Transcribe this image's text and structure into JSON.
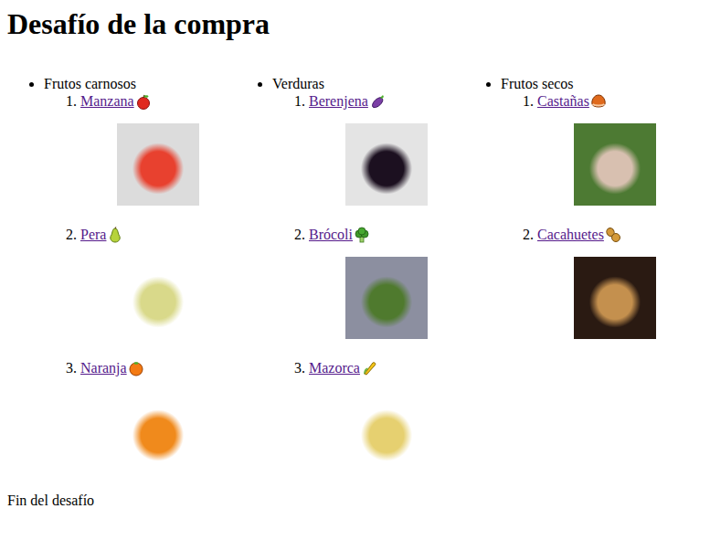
{
  "title": "Desafío de la compra",
  "categories": [
    {
      "name": "Frutos carnosos",
      "items": [
        {
          "number": "1.",
          "label": "Manzana"
        },
        {
          "number": "2.",
          "label": "Pera"
        },
        {
          "number": "3.",
          "label": "Naranja"
        }
      ]
    },
    {
      "name": "Verduras",
      "items": [
        {
          "number": "1.",
          "label": "Berenjena"
        },
        {
          "number": "2.",
          "label": "Brócoli"
        },
        {
          "number": "3.",
          "label": "Mazorca"
        }
      ]
    },
    {
      "name": "Frutos secos",
      "items": [
        {
          "number": "1.",
          "label": "Castañas"
        },
        {
          "number": "2.",
          "label": "Cacahuetes"
        }
      ]
    }
  ],
  "footer": "Fin del desafío"
}
